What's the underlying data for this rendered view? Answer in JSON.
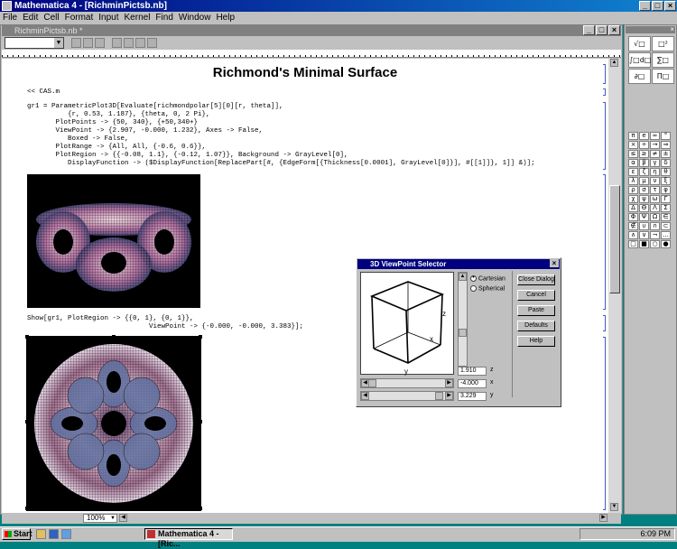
{
  "window": {
    "title": "Mathematica 4 - [RichminPictsb.nb]",
    "min": "_",
    "max": "□",
    "close": "×"
  },
  "menu": [
    "File",
    "Edit",
    "Cell",
    "Format",
    "Input",
    "Kernel",
    "Find",
    "Window",
    "Help"
  ],
  "document": {
    "tab_title": "RichminPictsb.nb *",
    "zoom": "100%"
  },
  "notebook": {
    "title": "Richmond's Minimal Surface",
    "input1": "<< CAS.m",
    "code1": [
      "gr1 = ParametricPlot3D[Evaluate[richmondpolar[5][0][r, theta]],",
      "          {r, 0.53, 1.187}, {theta, 0, 2 Pi},",
      "       PlotPoints -> {50, 340}, {+50,340+}",
      "       ViewPoint -> {2.907, -0.000, 1.232}, Axes -> False,",
      "          Boxed -> False,",
      "       PlotRange -> {All, All, {-0.6, 0.6}},",
      "       PlotRegion -> {{-0.08, 1.1}, {-0.12, 1.07}}, Background -> GrayLevel[0],",
      "          DisplayFunction -> ($DisplayFunction[ReplacePart[#, {EdgeForm[{Thickness[0.0001], GrayLevel[0]}], #[[1]]}, 1]] &)];"
    ],
    "code2": [
      "Show[gr1, PlotRegion -> {{0, 1}, {0, 1}},",
      "                              ViewPoint -> {-0.000, -0.000, 3.383}];"
    ]
  },
  "dialog": {
    "title": "3D ViewPoint Selector",
    "close": "×",
    "radio_cartesian": "Cartesian",
    "radio_spherical": "Spherical",
    "buttons": [
      "Close Dialog",
      "Cancel",
      "Paste",
      "Defaults",
      "Help"
    ],
    "z_value": "1.910",
    "z_label": "z",
    "x_value": "-4.000",
    "x_label": "x",
    "y_value": "3.229",
    "y_label": "y",
    "cube_z": "z",
    "cube_x": "x",
    "cube_y": "y"
  },
  "palette": {
    "close": "×",
    "big": [
      "√□",
      "□²",
      "∫□d□",
      "∑□",
      "∂□",
      "Π□"
    ],
    "symbols": [
      "π",
      "e",
      "∞",
      "°",
      "×",
      "÷",
      "→",
      "⇒",
      "≤",
      "≥",
      "≠",
      "±",
      "α",
      "β",
      "γ",
      "δ",
      "ε",
      "ζ",
      "η",
      "θ",
      "λ",
      "μ",
      "ν",
      "ξ",
      "ρ",
      "σ",
      "τ",
      "φ",
      "χ",
      "ψ",
      "ω",
      "Γ",
      "Δ",
      "Θ",
      "Λ",
      "Σ",
      "Φ",
      "Ψ",
      "Ω",
      "∈",
      "∉",
      "∪",
      "∩",
      "⊂",
      "∧",
      "∨",
      "¬",
      "…",
      "□",
      "■",
      "○",
      "●"
    ]
  },
  "taskbar": {
    "start": "Start",
    "task": "Mathematica 4 - [Ric...",
    "time": "6:09 PM"
  }
}
